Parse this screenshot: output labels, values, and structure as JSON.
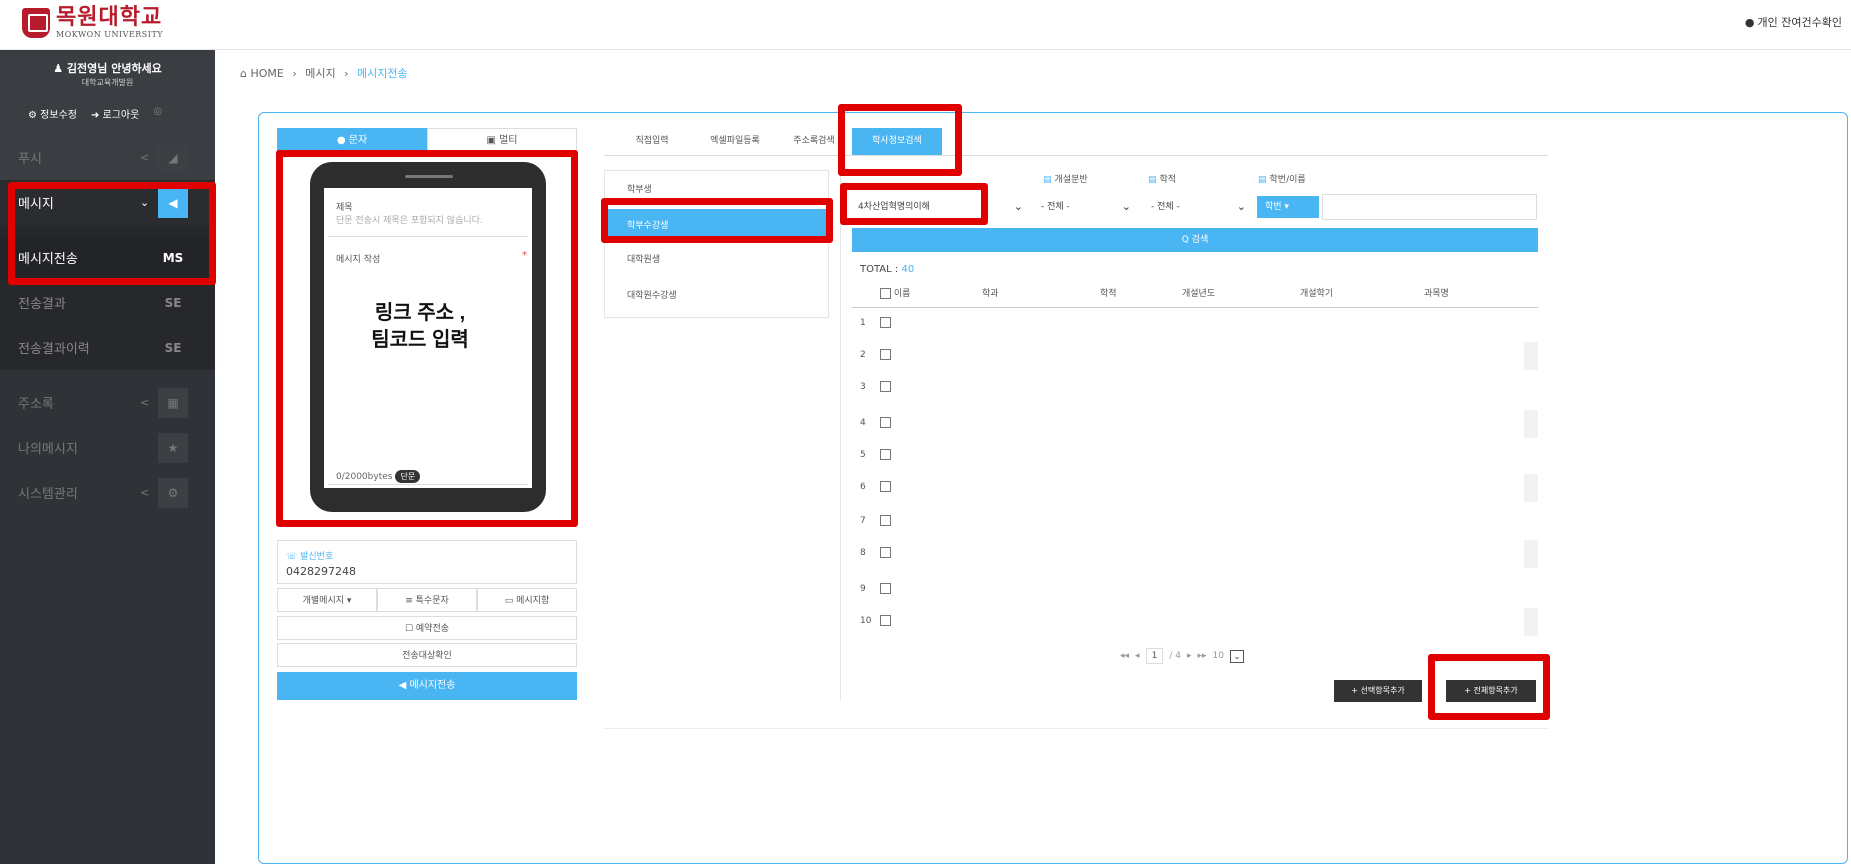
{
  "header": {
    "logo_text": "목원대학교",
    "logo_sub": "MOKWON UNIVERSITY",
    "right_link_icon": "chat-bubble",
    "right_link": "개인 잔여건수확인"
  },
  "sidebar": {
    "user_name": "김전영님 안녕하세요",
    "user_dept": "대학교육개발원",
    "link_info": "정보수정",
    "link_logout": "로그아웃",
    "menu": [
      {
        "label": "푸시",
        "chev": "<",
        "icon": "◢"
      },
      {
        "label": "메시지",
        "chev": "⌄",
        "icon": "◀"
      },
      {
        "label": "메시지전송",
        "icon": "MS"
      },
      {
        "label": "전송결과",
        "icon": "SE"
      },
      {
        "label": "전송결과이력",
        "icon": "SE"
      },
      {
        "label": "주소록",
        "chev": "<",
        "icon": "▦"
      },
      {
        "label": "나의메시지",
        "icon": "★"
      },
      {
        "label": "시스템관리",
        "chev": "<",
        "icon": "⚙"
      }
    ]
  },
  "breadcrumb": {
    "home": "HOME",
    "level1": "메시지",
    "current": "메시지전송",
    "sep": "›"
  },
  "compose": {
    "tab_sms": "문자",
    "tab_mail": "멀티",
    "subject_label": "제목",
    "subject_placeholder": "단문 전송시 제목은 포함되지 않습니다.",
    "message_label": "메시지 작성",
    "required_mark": "*",
    "byte_count": "0/2000bytes",
    "byte_badge": "단문",
    "annotation_line1": "링크 주소 ,",
    "annotation_line2": "팀코드 입력",
    "sender_label": "발신번호",
    "sender_number": "0428297248",
    "btn_individual": "개별메시지 ▾",
    "btn_special": "≡ 특수문자",
    "btn_msgbox": "메시지함",
    "btn_reserve": "예약전송",
    "btn_check": "전송대상확인",
    "btn_send": "메시지전송"
  },
  "target": {
    "tabs": [
      "직접입력",
      "엑셀파일등록",
      "주소록검색",
      "학사정보검색"
    ],
    "categories": [
      "학부생",
      "학부수강생",
      "대학원생",
      "대학원수강생"
    ],
    "filter_labels": [
      "개설분반",
      "학적",
      "학번/이름"
    ],
    "course_select": "4차산업혁명의이해",
    "select_all1": "- 전체 -",
    "select_all2": "- 전체 -",
    "hakbun_select": "학번 ▾",
    "search_btn": "Q 검색",
    "total_label": "TOTAL : ",
    "total_count": "40",
    "columns": [
      "이름",
      "학과",
      "학적",
      "개설년도",
      "개설학기",
      "과목명"
    ],
    "rows": [
      "1",
      "2",
      "3",
      "4",
      "5",
      "6",
      "7",
      "8",
      "9",
      "10"
    ],
    "pager": {
      "first": "◂◂",
      "prev": "◂",
      "page": "1",
      "of": "/ 4",
      "next": "▸",
      "last": "▸▸",
      "size": "10"
    },
    "btn_add_selected": "+ 선택항목추가",
    "btn_add_all": "+ 전체항목추가"
  }
}
